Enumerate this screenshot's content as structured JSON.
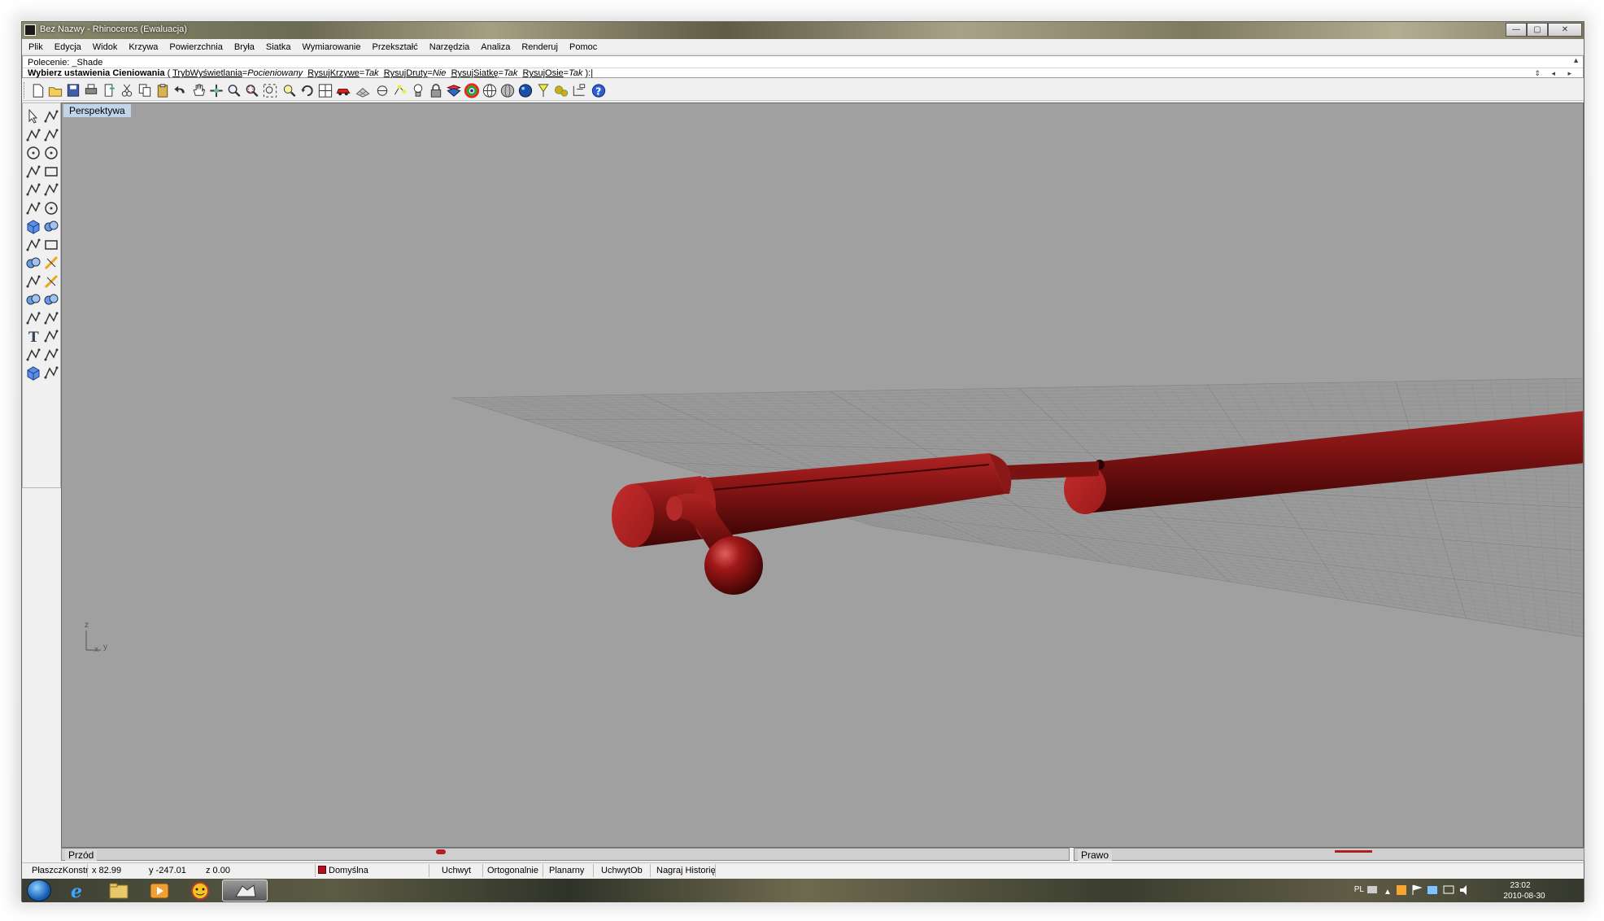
{
  "window": {
    "title": "Bez Nazwy - Rhinoceros (Ewaluacja)",
    "controls": {
      "minimize": "—",
      "maximize": "▢",
      "close": "✕"
    }
  },
  "menu": [
    "Plik",
    "Edycja",
    "Widok",
    "Krzywa",
    "Powierzchnia",
    "Bryła",
    "Siatka",
    "Wymiarowanie",
    "Przekształć",
    "Narzędzia",
    "Analiza",
    "Renderuj",
    "Pomoc"
  ],
  "command": {
    "history": "Polecenie: _Shade",
    "prompt_bold": "Wybierz ustawienia Cieniowania",
    "open_paren": " ( ",
    "options": [
      {
        "key": "TrybWyświetlania",
        "value": "Pocieniowany"
      },
      {
        "key": "RysujKrzywe",
        "value": "Tak"
      },
      {
        "key": "RysujDruty",
        "value": "Nie"
      },
      {
        "key": "RysujSiatkę",
        "value": "Tak"
      },
      {
        "key": "RysujOsie",
        "value": "Tak"
      }
    ],
    "close_paren": " ):"
  },
  "toolbar_icons": [
    "new-file-icon",
    "open-folder-icon",
    "save-icon",
    "print-icon",
    "export-icon",
    "cut-icon",
    "copy-icon",
    "paste-icon",
    "undo-icon",
    "pan-hand-icon",
    "rotate-view-icon",
    "zoom-icon",
    "zoom-window-icon",
    "zoom-extents-icon",
    "zoom-selected-icon",
    "rotate-icon",
    "viewport-layout-icon",
    "car-render-icon",
    "grid-snap-icon",
    "point-snap-icon",
    "object-snap-icon",
    "light-bulb-icon",
    "lock-icon",
    "layer-icon",
    "color-wheel-icon",
    "wireframe-sphere-icon",
    "shaded-sphere-icon",
    "rendered-sphere-icon",
    "render-light-icon",
    "settings-gears-icon",
    "dimension-icon",
    "help-icon"
  ],
  "viewport": {
    "title": "Perspektywa",
    "axis": {
      "z": "z",
      "x": "x",
      "y": "y"
    },
    "colors": {
      "background": "#a0a0a0",
      "grid": "#8e8e8e",
      "object": "#9b1c1c"
    }
  },
  "mini_viewports": {
    "front": "Przód",
    "right": "Prawo"
  },
  "status": {
    "cplane": "PłaszczKonstr",
    "x": "x 82.99",
    "y": "y -247.01",
    "z": "z 0.00",
    "layer": "Domyślna",
    "toggles": [
      "Uchwyt",
      "Ortogonalnie",
      "Planarny",
      "UchwytOb",
      "Nagraj Historię"
    ]
  },
  "taskbar": {
    "apps": [
      "internet-explorer-icon",
      "file-explorer-icon",
      "media-player-icon",
      "messenger-icon",
      "rhino-icon"
    ],
    "language": "PL",
    "time": "23:02",
    "date": "2010-08-30"
  }
}
